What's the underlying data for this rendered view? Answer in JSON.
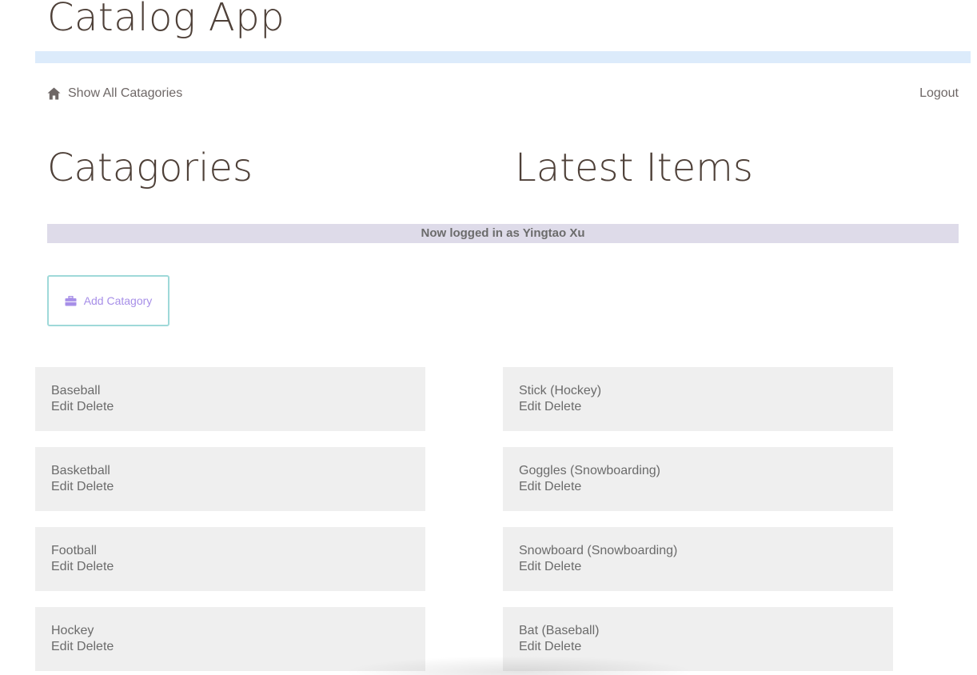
{
  "app": {
    "title": "Catalog App"
  },
  "nav": {
    "home_label": "Show All Catagories",
    "logout_label": "Logout"
  },
  "sections": {
    "categories_title": "Catagories",
    "latest_title": "Latest Items"
  },
  "banner": {
    "text": "Now logged in as Yingtao Xu"
  },
  "add_category": {
    "label": "Add Catagory",
    "icon": "briefcase-icon"
  },
  "actions": {
    "edit": "Edit",
    "delete": "Delete"
  },
  "categories": [
    "Baseball",
    "Basketball",
    "Football",
    "Hockey"
  ],
  "latest_items": [
    "Stick (Hockey)",
    "Goggles (Snowboarding)",
    "Snowboard (Snowboarding)",
    "Bat (Baseball)"
  ],
  "colors": {
    "header_bar": "#dcebfb",
    "banner_bg": "#dedbe9",
    "card_bg": "#efefef",
    "accent": "#a78fe8",
    "button_border": "#9fd9d9",
    "title_text": "#4e4038"
  }
}
